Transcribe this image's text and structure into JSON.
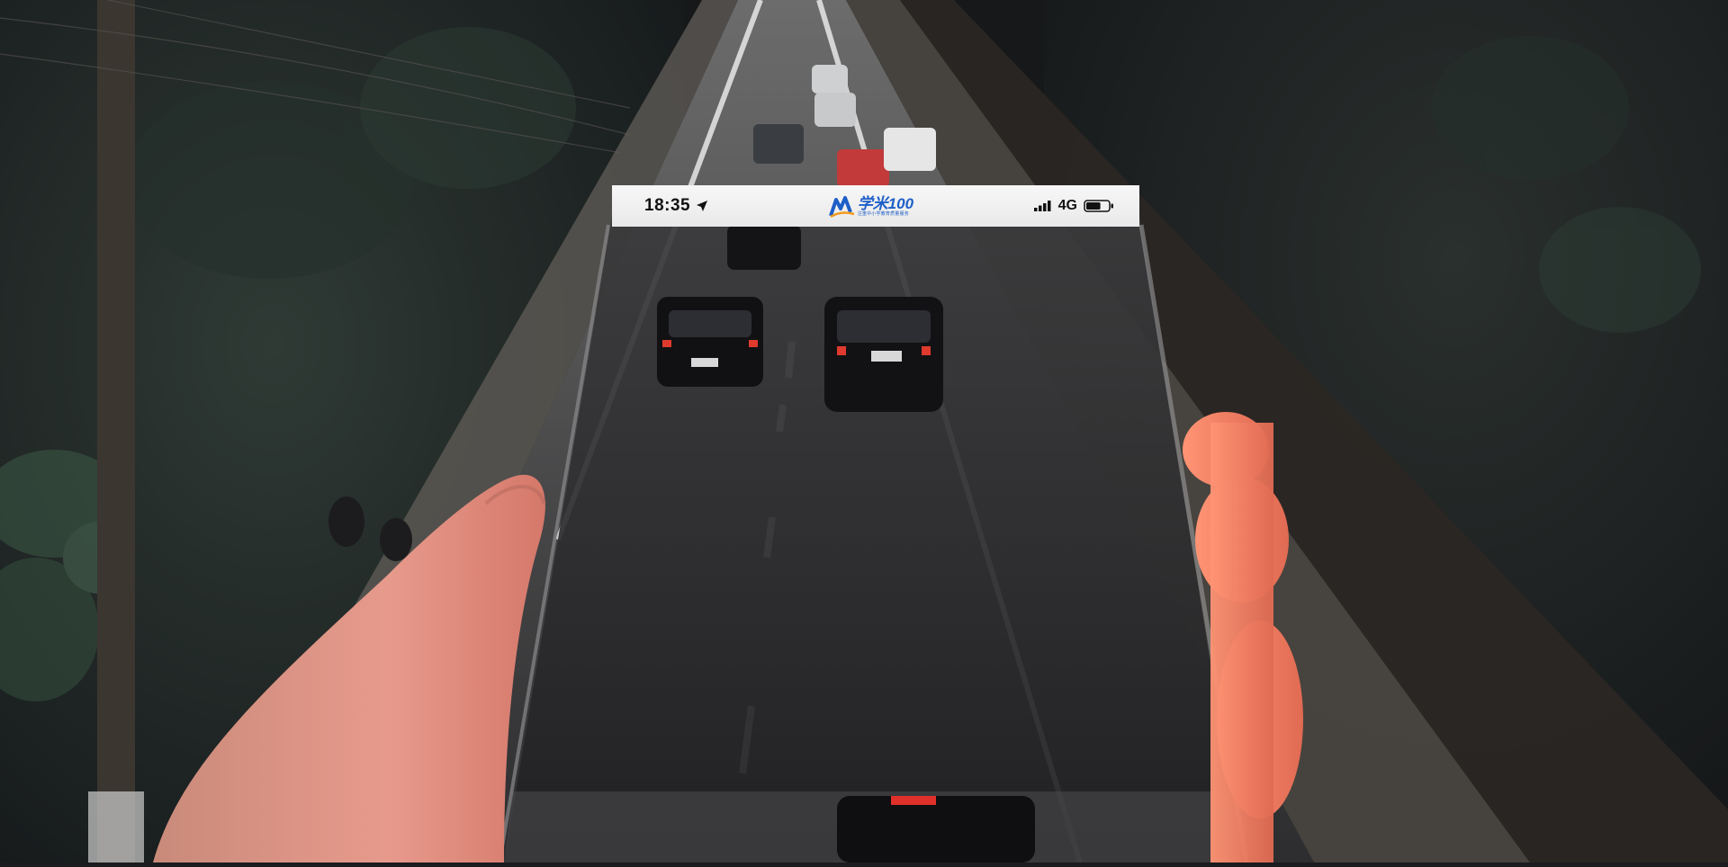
{
  "statusbar": {
    "time": "18:35",
    "network": "4G",
    "signal_bars": 4,
    "battery_level": 0.65,
    "logo": {
      "text": "学米100",
      "subtitle": "注重中小学教育质量服务"
    }
  },
  "colors": {
    "brand_blue": "#1e5ec8",
    "brand_orange": "#f39a1e",
    "status_bg": "#f2f2f2"
  },
  "icons": [
    "location-arrow-icon",
    "logo-mark-icon",
    "signal-icon",
    "battery-icon"
  ]
}
